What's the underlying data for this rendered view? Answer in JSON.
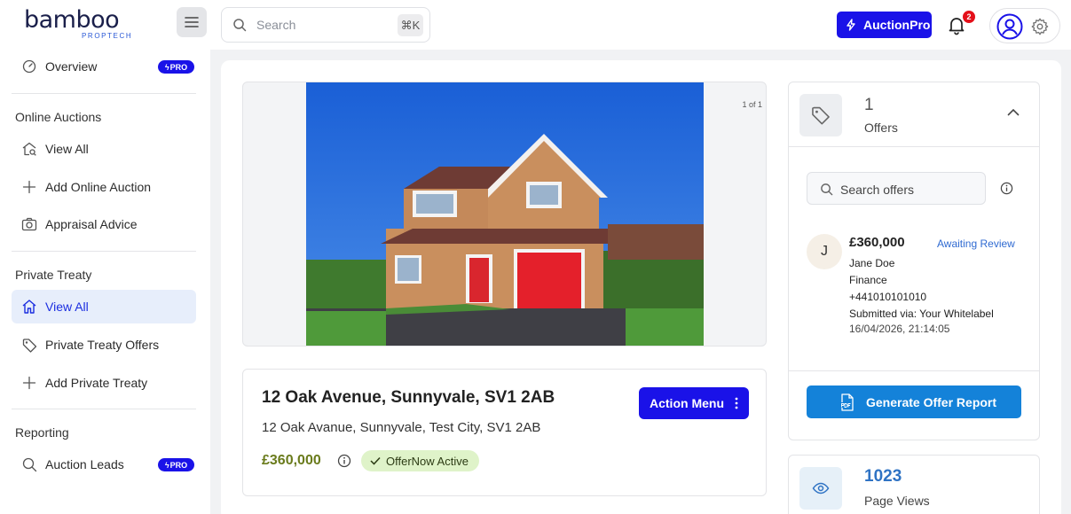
{
  "brand": {
    "name": "bamboo",
    "subtitle": "PROPTECH"
  },
  "header": {
    "search_placeholder": "Search",
    "search_shortcut": "⌘K",
    "auction_pro_label": "AuctionPro",
    "notification_count": "2"
  },
  "sidebar": {
    "overview": {
      "label": "Overview",
      "badge": "PRO"
    },
    "online_auctions": {
      "title": "Online Auctions",
      "items": [
        {
          "label": "View All",
          "icon": "house-search-icon"
        },
        {
          "label": "Add Online Auction",
          "icon": "plus-icon"
        },
        {
          "label": "Appraisal Advice",
          "icon": "camera-icon"
        }
      ]
    },
    "private_treaty": {
      "title": "Private Treaty",
      "items": [
        {
          "label": "View All",
          "icon": "home-icon",
          "active": true
        },
        {
          "label": "Private Treaty Offers",
          "icon": "tag-icon"
        },
        {
          "label": "Add Private Treaty",
          "icon": "plus-icon"
        }
      ]
    },
    "reporting": {
      "title": "Reporting",
      "items": [
        {
          "label": "Auction Leads",
          "icon": "search-icon",
          "badge": "PRO"
        }
      ]
    }
  },
  "gallery": {
    "counter": "1 of 1"
  },
  "property": {
    "title": "12 Oak Avenue, Sunnyvale, SV1 2AB",
    "address": "12 Oak Avanue, Sunnyvale, Test City, SV1 2AB",
    "price": "£360,000",
    "status": "OfferNow Active",
    "action_menu_label": "Action Menu"
  },
  "offers": {
    "count": "1",
    "label": "Offers",
    "search_placeholder": "Search offers",
    "items": [
      {
        "initial": "J",
        "amount": "£360,000",
        "status": "Awaiting Review",
        "name": "Jane Doe",
        "finance": "Finance",
        "phone": "+441010101010",
        "submitted": "Submitted via: Your Whitelabel",
        "date": "16/04/2026, 21:14:05"
      }
    ],
    "report_button_label": "Generate Offer Report"
  },
  "views": {
    "count": "1023",
    "label": "Page Views"
  },
  "colors": {
    "brand_blue": "#1a12e8",
    "report_blue": "#1482d9",
    "price_green": "#6a7b1c",
    "status_bg": "#dff3c9"
  }
}
